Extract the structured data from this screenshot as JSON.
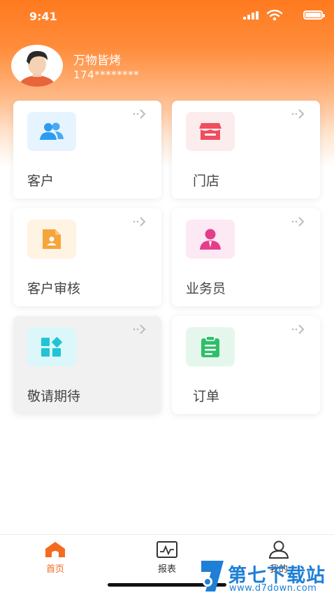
{
  "status": {
    "time": "9:41"
  },
  "profile": {
    "name": "万物皆烤",
    "phone": "174********"
  },
  "cards": [
    {
      "label": "客户",
      "icon": "users-icon",
      "color": "#2d9cf0",
      "bg": "#e6f4ff"
    },
    {
      "label": "门店",
      "icon": "store-icon",
      "color": "#f04e5e",
      "bg": "#fdeced"
    },
    {
      "label": "客户审核",
      "icon": "id-document-icon",
      "color": "#f5a53a",
      "bg": "#fff3e3"
    },
    {
      "label": "业务员",
      "icon": "salesperson-icon",
      "color": "#e63d8a",
      "bg": "#fde9f3"
    },
    {
      "label": "敬请期待",
      "icon": "grid-icon",
      "color": "#21c4d6",
      "bg": "#dcf7fa"
    },
    {
      "label": "订单",
      "icon": "clipboard-icon",
      "color": "#2fbf6a",
      "bg": "#e5f7ec"
    }
  ],
  "tabs": [
    {
      "label": "首页",
      "icon": "home-icon",
      "active": true
    },
    {
      "label": "报表",
      "icon": "chart-icon",
      "active": false
    },
    {
      "label": "我的",
      "icon": "user-icon",
      "active": false
    }
  ],
  "watermark": {
    "title": "第七下载站",
    "url": "www.d7down.com"
  },
  "accent": "#f46a1e"
}
